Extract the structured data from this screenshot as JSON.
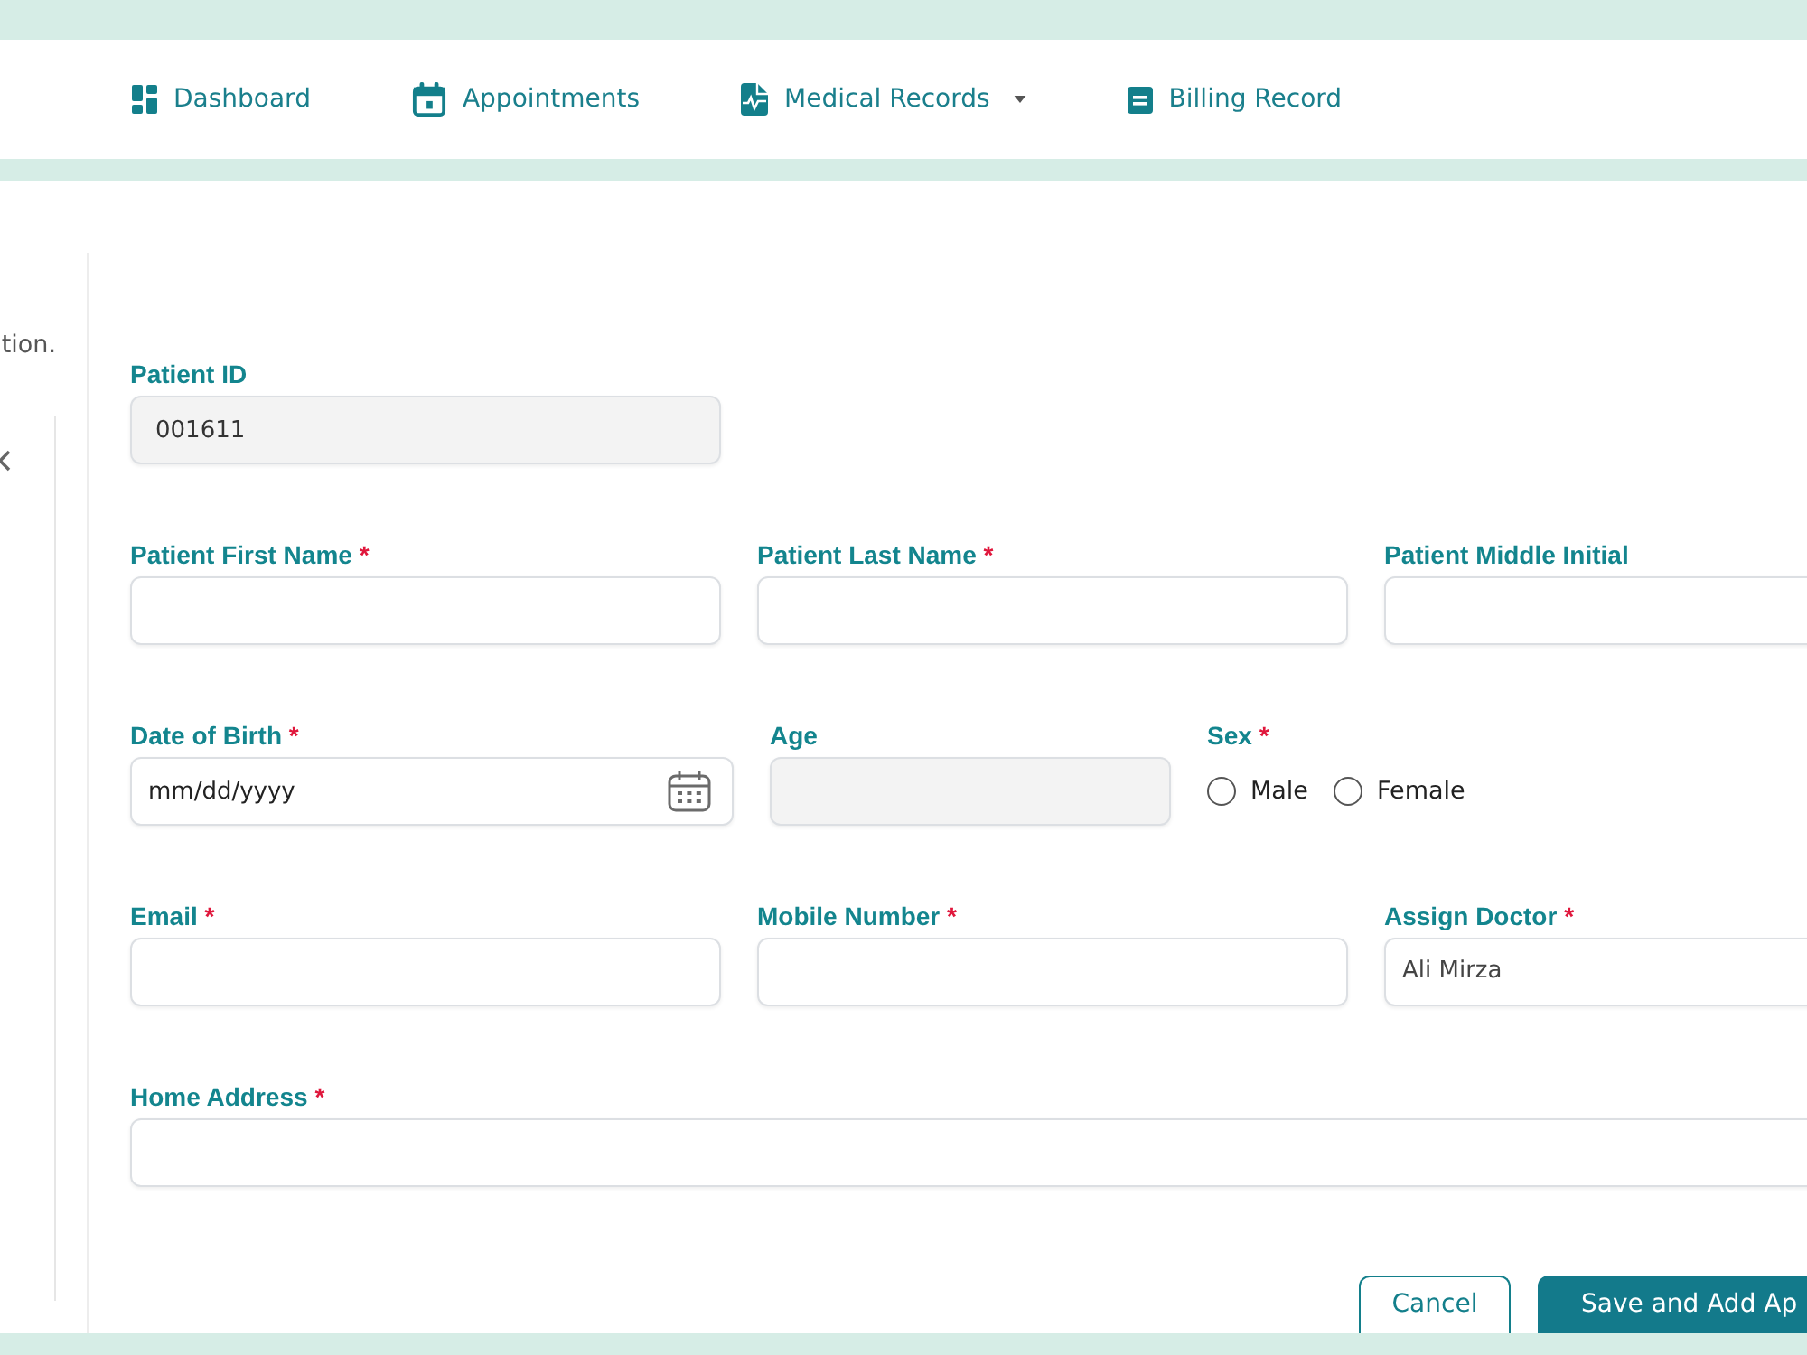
{
  "nav": {
    "items": [
      {
        "label": "Dashboard",
        "dropdown": false
      },
      {
        "label": "Appointments",
        "dropdown": false
      },
      {
        "label": "Medical Records",
        "dropdown": true
      },
      {
        "label": "Billing Record",
        "dropdown": false
      }
    ]
  },
  "side_panel": {
    "text": "tion."
  },
  "form": {
    "rows": [
      {
        "fields": [
          {
            "kind": "text",
            "label": "Patient ID",
            "value": "001611",
            "disabled": true
          }
        ]
      },
      {
        "fields": [
          {
            "kind": "text",
            "label": "Patient First Name",
            "required_mark": "*",
            "disabled": false
          },
          {
            "kind": "text",
            "label": "Patient Last Name",
            "required_mark": "*",
            "disabled": false
          },
          {
            "kind": "text",
            "label": "Patient Middle Initial",
            "disabled": false
          }
        ]
      },
      {
        "fields": [
          {
            "kind": "date",
            "label": "Date of Birth",
            "required_mark": "*",
            "placeholder": "mm/dd/yyyy",
            "disabled": false
          },
          {
            "kind": "text",
            "label": "Age",
            "disabled": true
          },
          {
            "kind": "radio",
            "label": "Sex",
            "required_mark": "*",
            "options": [
              {
                "label": "Male",
                "selected": false
              },
              {
                "label": "Female",
                "selected": false
              }
            ]
          }
        ]
      },
      {
        "fields": [
          {
            "kind": "text",
            "label": "Email",
            "required_mark": "*",
            "disabled": false
          },
          {
            "kind": "text",
            "label": "Mobile Number",
            "required_mark": "*",
            "disabled": false
          },
          {
            "kind": "select",
            "label": "Assign Doctor",
            "required_mark": "*",
            "value": "Ali Mirza"
          }
        ]
      },
      {
        "fields": [
          {
            "kind": "text",
            "label": "Home Address",
            "required_mark": "*",
            "disabled": false
          }
        ]
      }
    ],
    "buttons": [
      {
        "label": "Cancel",
        "kind": "secondary"
      },
      {
        "label": "Save and Add Ap",
        "kind": "primary"
      }
    ]
  }
}
